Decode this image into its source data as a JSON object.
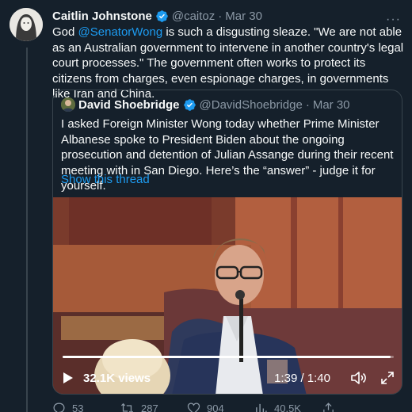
{
  "tweet": {
    "author_name": "Caitlin Johnstone",
    "handle": "@caitoz",
    "separator": "·",
    "date": "Mar 30",
    "text_before": "God ",
    "mention": "@SenatorWong",
    "text_after": " is such a disgusting sleaze. \"We are not able as an Australian government to intervene in another country's legal court processes.\" The government often works to protect its citizens from charges, even espionage charges, in governments like Iran and China.",
    "more_label": "···"
  },
  "quote": {
    "author_name": "David Shoebridge",
    "handle": "@DavidShoebridge",
    "separator": "·",
    "date": "Mar 30",
    "text": "I asked Foreign Minister Wong today whether Prime Minister Albanese spoke to President Biden about the ongoing prosecution and detention of Julian Assange during their recent meeting with in San Diego. Here’s the “answer” - judge it for yourself.",
    "show_thread": "Show this thread"
  },
  "video": {
    "views": "32.1K views",
    "time": "1:39 / 1:40",
    "progress": 0.99
  },
  "actions": {
    "reply_count": "53",
    "retweet_count": "287",
    "like_count": "904",
    "views_count": "40.5K"
  },
  "colors": {
    "background": "#15202b",
    "accent": "#1d9bf0",
    "muted": "#8b98a5",
    "border": "#38444d"
  },
  "icons": [
    "verified-badge-icon",
    "play-icon",
    "volume-icon",
    "expand-icon",
    "reply-icon",
    "retweet-icon",
    "like-icon",
    "views-icon",
    "share-icon",
    "more-icon"
  ]
}
